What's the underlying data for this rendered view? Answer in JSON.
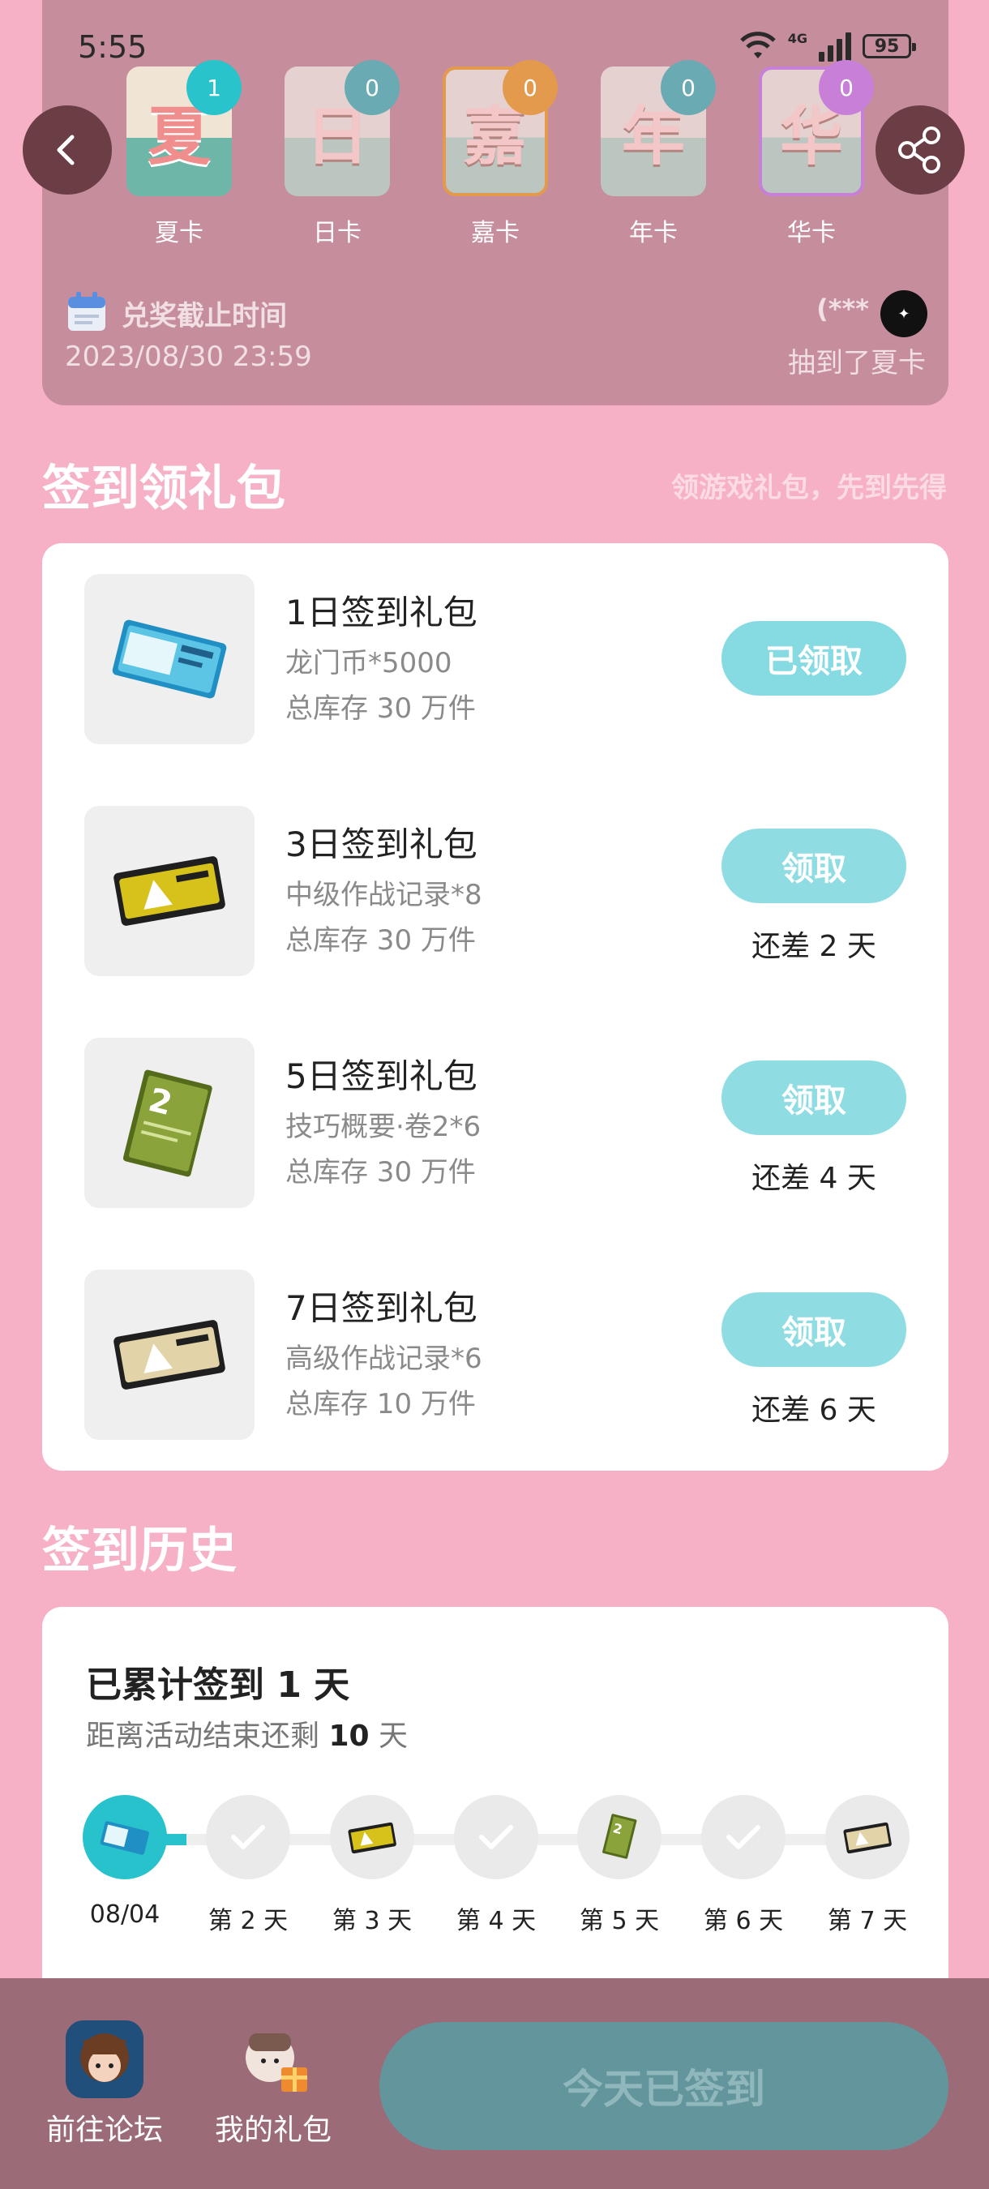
{
  "status_bar": {
    "time": "5:55",
    "network": "4G",
    "battery": "95"
  },
  "cards": [
    {
      "glyph": "夏",
      "label": "夏卡",
      "count": "1",
      "badge_color": "#29c3cc"
    },
    {
      "glyph": "日",
      "label": "日卡",
      "count": "0",
      "badge_color": "#6aaab2"
    },
    {
      "glyph": "嘉",
      "label": "嘉卡",
      "count": "0",
      "badge_color": "#e49a4d"
    },
    {
      "glyph": "年",
      "label": "年卡",
      "count": "0",
      "badge_color": "#6aaab2"
    },
    {
      "glyph": "华",
      "label": "华卡",
      "count": "0",
      "badge_color": "#c77fd8"
    }
  ],
  "deadline": {
    "label": "兑奖截止时间",
    "date": "2023/08/30 23:59"
  },
  "winner": {
    "name": "(***",
    "text": "抽到了夏卡"
  },
  "signin_section": {
    "title": "签到领礼包",
    "subtitle": "领游戏礼包，先到先得"
  },
  "gifts": [
    {
      "name": "1日签到礼包",
      "desc": "龙门币*5000",
      "stock": "总库存 30 万件",
      "button": "已领取",
      "remain": ""
    },
    {
      "name": "3日签到礼包",
      "desc": "中级作战记录*8",
      "stock": "总库存 30 万件",
      "button": "领取",
      "remain": "还差 2 天"
    },
    {
      "name": "5日签到礼包",
      "desc": "技巧概要·卷2*6",
      "stock": "总库存 30 万件",
      "button": "领取",
      "remain": "还差 4 天"
    },
    {
      "name": "7日签到礼包",
      "desc": "高级作战记录*6",
      "stock": "总库存 10 万件",
      "button": "领取",
      "remain": "还差 6 天"
    }
  ],
  "history_section": {
    "title": "签到历史"
  },
  "history": {
    "total_prefix": "已累计签到 ",
    "total_days": "1",
    "total_suffix": " 天",
    "remain_prefix": "距离活动结束还剩 ",
    "remain_days": "10",
    "remain_suffix": " 天",
    "days": [
      "08/04",
      "第 2 天",
      "第 3 天",
      "第 4 天",
      "第 5 天",
      "第 6 天",
      "第 7 天"
    ]
  },
  "bottom": {
    "forum": "前往论坛",
    "gifts": "我的礼包",
    "checkin": "今天已签到"
  },
  "colors": {
    "background": "#f6b1c6",
    "accent": "#27c2cc",
    "button": "#8fdde3"
  }
}
